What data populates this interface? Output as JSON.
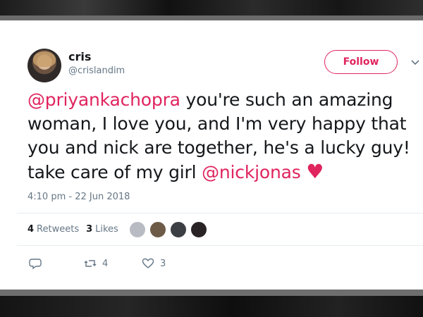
{
  "tweet": {
    "display_name": "cris",
    "handle": "@crislandim",
    "follow_label": "Follow",
    "text_segments": [
      {
        "type": "mention",
        "text": "@priyankachopra"
      },
      {
        "type": "text",
        "text": " you're such an amazing woman, I love you, and I'm very happy that you and nick are together, he's a lucky guy! take care of my girl "
      },
      {
        "type": "mention",
        "text": "@nickjonas"
      },
      {
        "type": "text",
        "text": " "
      },
      {
        "type": "emoji",
        "text": "♥"
      }
    ],
    "timestamp": "4:10 pm - 22 Jun 2018",
    "stats": {
      "retweets_count": "4",
      "retweets_label": "Retweets",
      "likes_count": "3",
      "likes_label": "Likes"
    },
    "likers": [
      {
        "color": "#b8bcc2"
      },
      {
        "color": "#6d5a47"
      },
      {
        "color": "#3c3f44"
      },
      {
        "color": "#2a2325"
      }
    ],
    "actions": {
      "reply_icon": "reply-icon",
      "retweet_icon": "retweet-icon",
      "retweet_count": "4",
      "like_icon": "heart-icon",
      "like_count": "3"
    }
  },
  "colors": {
    "accent": "#e0245e",
    "text": "#14171a",
    "muted": "#657786"
  }
}
